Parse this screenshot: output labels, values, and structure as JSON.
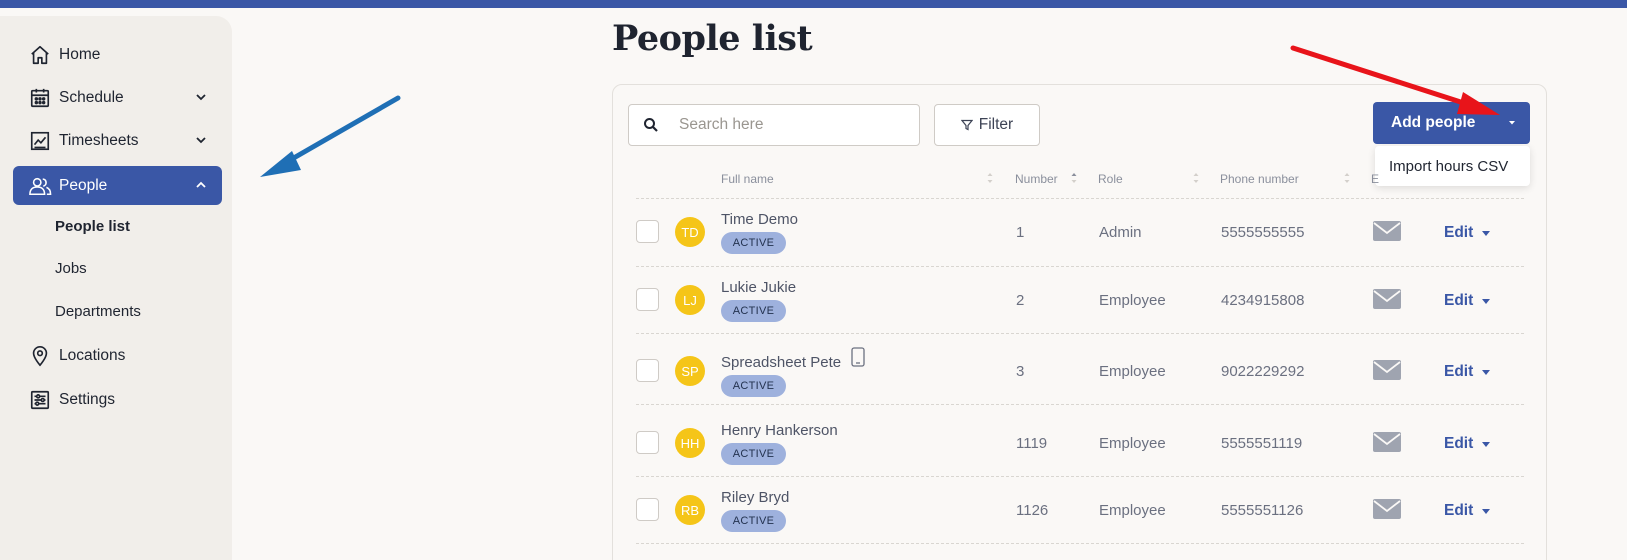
{
  "sidebar": {
    "items": [
      {
        "label": "Home"
      },
      {
        "label": "Schedule"
      },
      {
        "label": "Timesheets"
      },
      {
        "label": "People"
      },
      {
        "label": "Locations"
      },
      {
        "label": "Settings"
      }
    ],
    "people_subitems": [
      {
        "label": "People list"
      },
      {
        "label": "Jobs"
      },
      {
        "label": "Departments"
      }
    ]
  },
  "main": {
    "title": "People list",
    "search_placeholder": "Search here",
    "filter_label": "Filter",
    "add_people_label": "Add people",
    "dropdown_item": "Import hours CSV"
  },
  "table": {
    "headers": {
      "full_name": "Full name",
      "number": "Number",
      "role": "Role",
      "phone": "Phone number",
      "email": "E"
    },
    "rows": [
      {
        "initials": "TD",
        "name": "Time Demo",
        "status": "ACTIVE",
        "number": "1",
        "role": "Admin",
        "phone": "5555555555",
        "action": "Edit"
      },
      {
        "initials": "LJ",
        "name": "Lukie Jukie",
        "status": "ACTIVE",
        "number": "2",
        "role": "Employee",
        "phone": "4234915808",
        "action": "Edit"
      },
      {
        "initials": "SP",
        "name": "Spreadsheet Pete",
        "status": "ACTIVE",
        "number": "3",
        "role": "Employee",
        "phone": "9022229292",
        "action": "Edit"
      },
      {
        "initials": "HH",
        "name": "Henry Hankerson",
        "status": "ACTIVE",
        "number": "1119",
        "role": "Employee",
        "phone": "5555551119",
        "action": "Edit"
      },
      {
        "initials": "RB",
        "name": "Riley Bryd",
        "status": "ACTIVE",
        "number": "1126",
        "role": "Employee",
        "phone": "5555551126",
        "action": "Edit"
      }
    ]
  },
  "colors": {
    "brand": "#3a57a6",
    "avatar": "#f5c518",
    "badge": "#9eb1dd",
    "annotation_blue": "#1f6fb5",
    "annotation_red": "#e8141a"
  }
}
